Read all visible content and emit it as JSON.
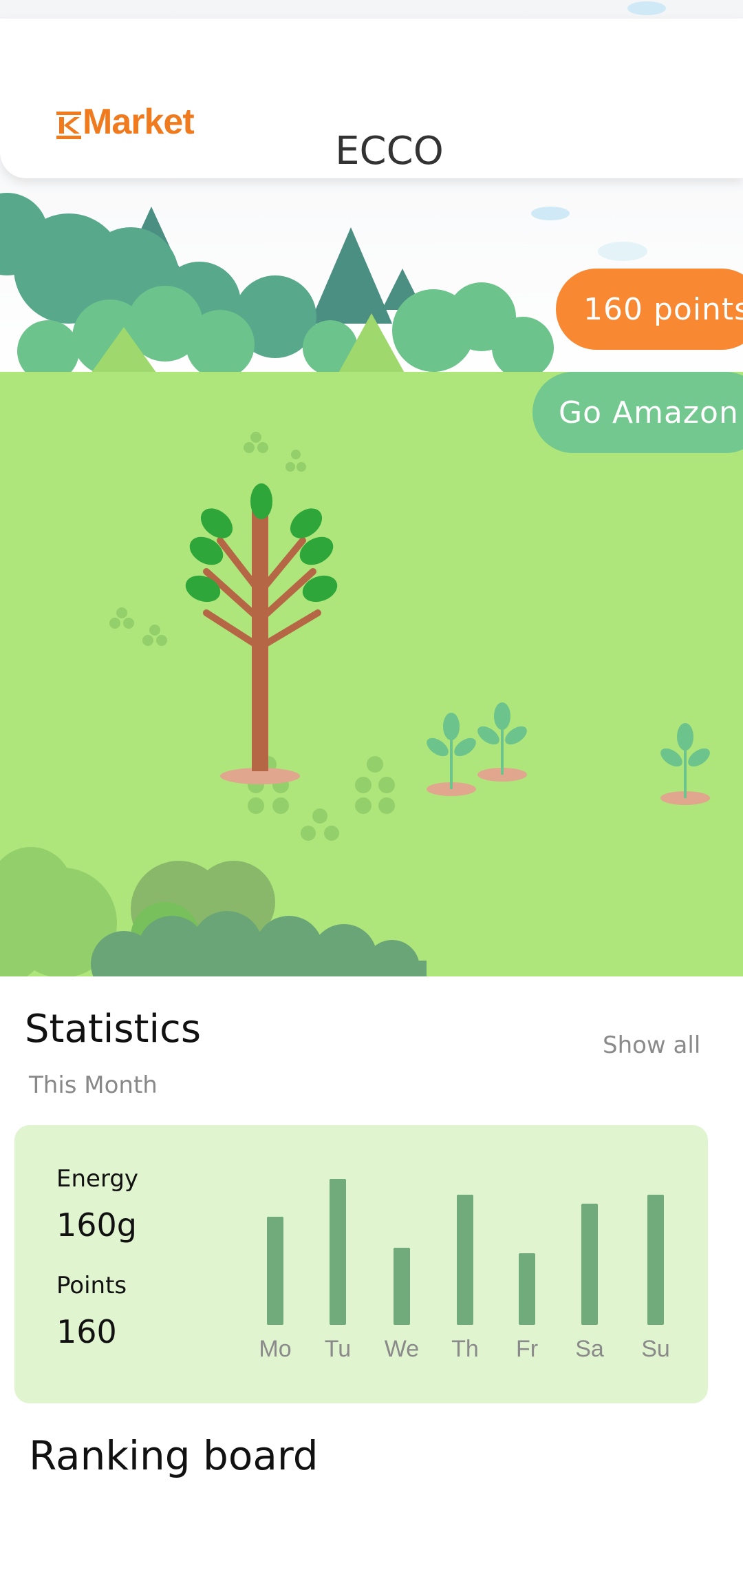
{
  "header": {
    "logo_text": "Market",
    "store_name": "ECCO"
  },
  "scene": {
    "points_label": "160 points",
    "amazon_label": "Go Amazon"
  },
  "statistics": {
    "title": "Statistics",
    "subtitle": "This Month",
    "show_all": "Show all",
    "energy_label": "Energy",
    "energy_value": "160g",
    "points_label": "Points",
    "points_value": "160"
  },
  "chart_data": {
    "type": "bar",
    "categories": [
      "Mo",
      "Tu",
      "We",
      "Th",
      "Fr",
      "Sa",
      "Su"
    ],
    "values": [
      0.74,
      1.0,
      0.53,
      0.89,
      0.49,
      0.83,
      0.89
    ],
    "colors": {
      "bar": "#71aa7b",
      "card": "#dff4cf"
    }
  },
  "ranking": {
    "title": "Ranking board"
  },
  "colors": {
    "accent_orange": "#f88832",
    "accent_green": "#73c890",
    "grass": "#aee67b"
  }
}
